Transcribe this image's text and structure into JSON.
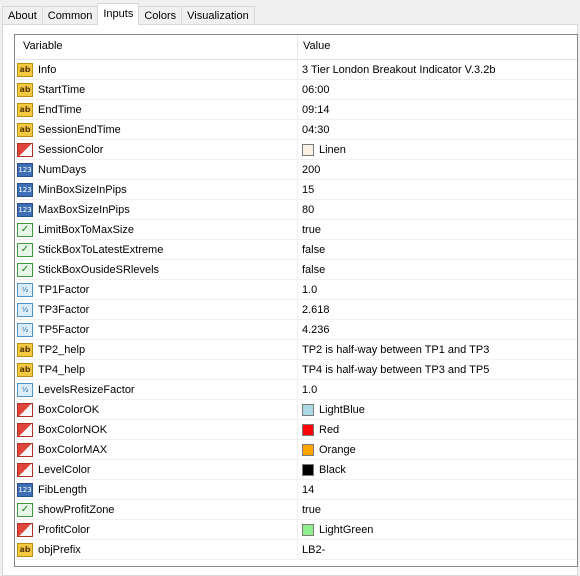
{
  "tabs": [
    "About",
    "Common",
    "Inputs",
    "Colors",
    "Visualization"
  ],
  "active_tab": "Inputs",
  "columns": {
    "variable": "Variable",
    "value": "Value"
  },
  "icon_names": {
    "ab": "string-type-icon",
    "num": "integer-type-icon",
    "clr": "color-type-icon",
    "bool": "boolean-type-icon",
    "dbl": "double-type-icon"
  },
  "rows": [
    {
      "variable": "Info",
      "type": "ab",
      "value": "3 Tier London Breakout Indicator V.3.2b"
    },
    {
      "variable": "StartTime",
      "type": "ab",
      "value": "06:00"
    },
    {
      "variable": "EndTime",
      "type": "ab",
      "value": "09:14"
    },
    {
      "variable": "SessionEndTime",
      "type": "ab",
      "value": "04:30"
    },
    {
      "variable": "SessionColor",
      "type": "clr",
      "value": "Linen",
      "swatch": "#faf0e6"
    },
    {
      "variable": "NumDays",
      "type": "num",
      "value": "200"
    },
    {
      "variable": "MinBoxSizeInPips",
      "type": "num",
      "value": "15"
    },
    {
      "variable": "MaxBoxSizeInPips",
      "type": "num",
      "value": "80"
    },
    {
      "variable": "LimitBoxToMaxSize",
      "type": "bool",
      "value": "true"
    },
    {
      "variable": "StickBoxToLatestExtreme",
      "type": "bool",
      "value": "false"
    },
    {
      "variable": "StickBoxOusideSRlevels",
      "type": "bool",
      "value": "false"
    },
    {
      "variable": "TP1Factor",
      "type": "dbl",
      "value": "1.0"
    },
    {
      "variable": "TP3Factor",
      "type": "dbl",
      "value": "2.618"
    },
    {
      "variable": "TP5Factor",
      "type": "dbl",
      "value": "4.236"
    },
    {
      "variable": "TP2_help",
      "type": "ab",
      "value": "TP2 is half-way between TP1 and TP3"
    },
    {
      "variable": "TP4_help",
      "type": "ab",
      "value": "TP4 is half-way between TP3 and TP5"
    },
    {
      "variable": "LevelsResizeFactor",
      "type": "dbl",
      "value": "1.0"
    },
    {
      "variable": "BoxColorOK",
      "type": "clr",
      "value": "LightBlue",
      "swatch": "#add8e6"
    },
    {
      "variable": "BoxColorNOK",
      "type": "clr",
      "value": "Red",
      "swatch": "#ff0000"
    },
    {
      "variable": "BoxColorMAX",
      "type": "clr",
      "value": "Orange",
      "swatch": "#ffa500"
    },
    {
      "variable": "LevelColor",
      "type": "clr",
      "value": "Black",
      "swatch": "#000000"
    },
    {
      "variable": "FibLength",
      "type": "num",
      "value": "14"
    },
    {
      "variable": "showProfitZone",
      "type": "bool",
      "value": "true"
    },
    {
      "variable": "ProfitColor",
      "type": "clr",
      "value": "LightGreen",
      "swatch": "#90ee90"
    },
    {
      "variable": "objPrefix",
      "type": "ab",
      "value": "LB2-"
    }
  ]
}
